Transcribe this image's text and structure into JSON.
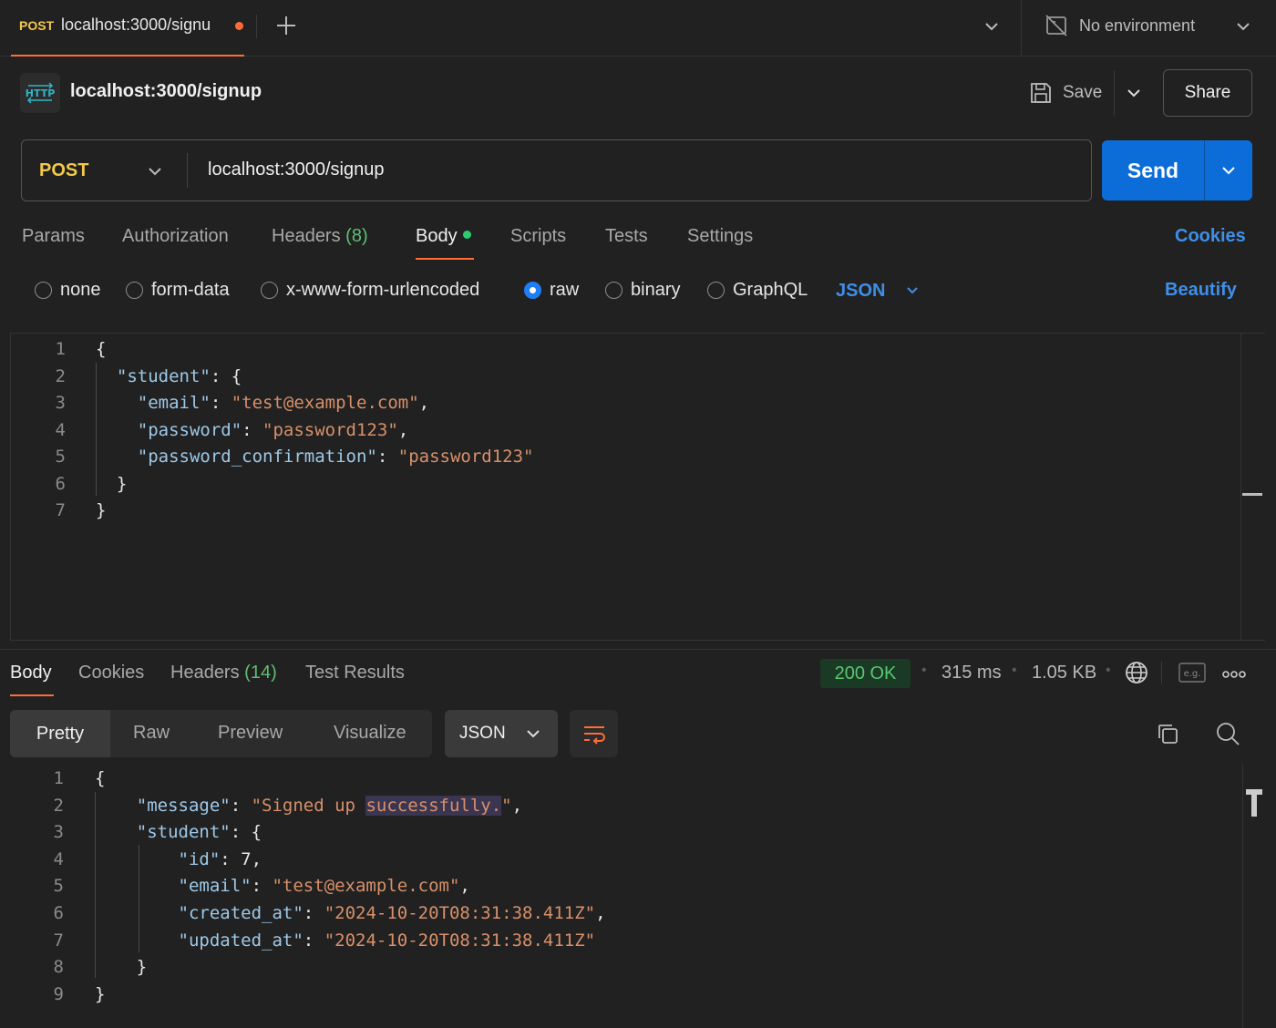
{
  "tabbar": {
    "active_tab": {
      "method": "POST",
      "url": "localhost:3000/signu",
      "unsaved": true
    },
    "environment": "No environment"
  },
  "request": {
    "title": "localhost:3000/signup",
    "save_label": "Save",
    "share_label": "Share",
    "method": "POST",
    "url": "localhost:3000/signup",
    "send_label": "Send",
    "tabs": [
      {
        "label": "Params"
      },
      {
        "label": "Authorization"
      },
      {
        "label": "Headers",
        "count": "(8)"
      },
      {
        "label": "Body",
        "active": true
      },
      {
        "label": "Scripts"
      },
      {
        "label": "Tests"
      },
      {
        "label": "Settings"
      }
    ],
    "cookies_label": "Cookies",
    "body_types": [
      "none",
      "form-data",
      "x-www-form-urlencoded",
      "raw",
      "binary",
      "GraphQL"
    ],
    "selected_body_type": "raw",
    "language": "JSON",
    "beautify_label": "Beautify",
    "line_numbers": [
      "1",
      "2",
      "3",
      "4",
      "5",
      "6",
      "7"
    ]
  },
  "response": {
    "tabs": [
      {
        "label": "Body",
        "active": true
      },
      {
        "label": "Cookies"
      },
      {
        "label": "Headers",
        "count": "(14)"
      },
      {
        "label": "Test Results"
      }
    ],
    "status": "200 OK",
    "time": "315 ms",
    "size": "1.05 KB",
    "views": [
      "Pretty",
      "Raw",
      "Preview",
      "Visualize"
    ],
    "selected_view": "Pretty",
    "language": "JSON",
    "line_numbers": [
      "1",
      "2",
      "3",
      "4",
      "5",
      "6",
      "7",
      "8",
      "9"
    ]
  },
  "colors": {
    "accent_orange": "#ff6c37",
    "method_yellow": "#f2c94c",
    "primary_blue": "#0c6dd8",
    "link_blue": "#3e8fe8",
    "status_green": "#57c76e",
    "json_key": "#9ec9e8",
    "json_string": "#d8906a"
  },
  "icons": [
    "http-icon",
    "plus-icon",
    "chevron-down-icon",
    "no-environment-icon",
    "save-icon",
    "globe-icon",
    "example-icon",
    "more-icon",
    "wrap-icon",
    "copy-icon",
    "search-icon"
  ]
}
